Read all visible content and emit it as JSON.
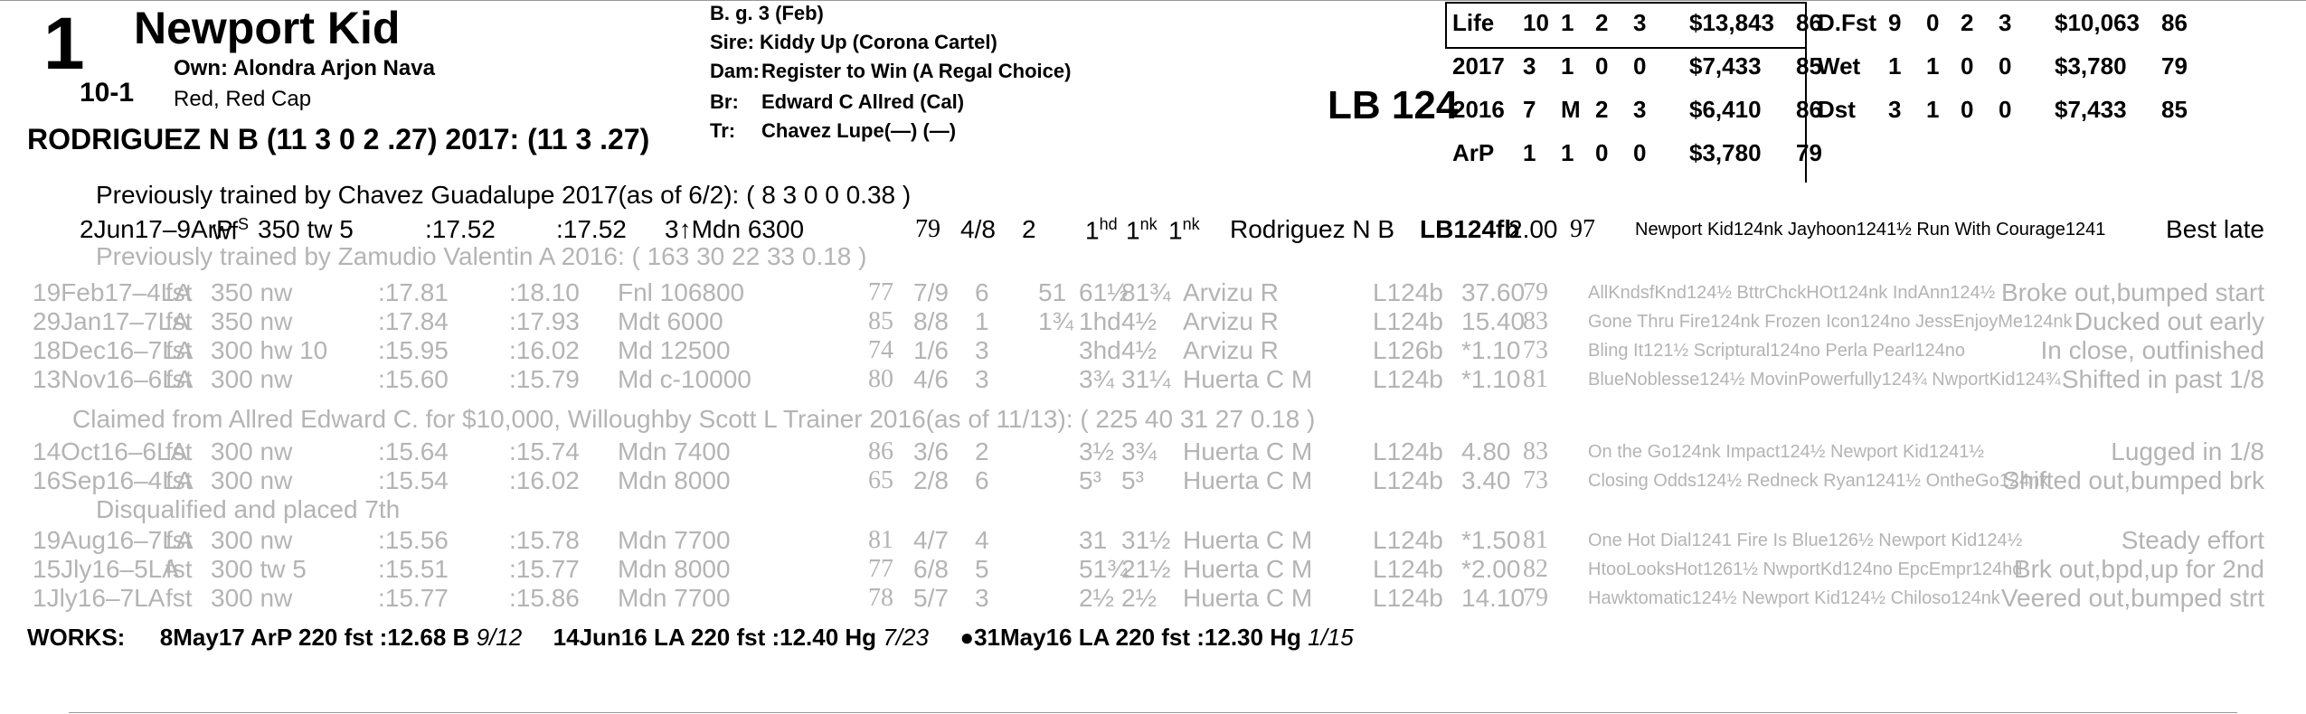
{
  "header": {
    "program_number": "1",
    "horse_name": "Newport Kid",
    "owner": "Own: Alondra Arjon Nava",
    "morning_line": "10-1",
    "silks": "Red, Red Cap",
    "jockey": "RODRIGUEZ N B (11 3 0 2 .27) 2017: (11 3 .27)",
    "sex_age": "B. g. 3 (Feb)",
    "sire_label": "Sire:",
    "sire": "Kiddy Up (Corona Cartel)",
    "dam_label": "Dam:",
    "dam": "Register to Win (A Regal Choice)",
    "breeder_label": "Br:",
    "breeder": "Edward C Allred (Cal)",
    "trainer_label": "Tr:",
    "trainer": "Chavez Lupe(—) (—)",
    "weight": "LB 124"
  },
  "stats_left": [
    {
      "label": "Life",
      "starts": "10",
      "w": "1",
      "p": "2",
      "s": "3",
      "earnings": "$13,843",
      "speed": "86"
    },
    {
      "label": "2017",
      "starts": "3",
      "w": "1",
      "p": "0",
      "s": "0",
      "earnings": "$7,433",
      "speed": "85"
    },
    {
      "label": "2016",
      "starts": "7",
      "w": "M",
      "p": "2",
      "s": "3",
      "earnings": "$6,410",
      "speed": "86"
    },
    {
      "label": "ArP",
      "starts": "1",
      "w": "1",
      "p": "0",
      "s": "0",
      "earnings": "$3,780",
      "speed": "79"
    }
  ],
  "stats_right": [
    {
      "label": "D.Fst",
      "starts": "9",
      "w": "0",
      "p": "2",
      "s": "3",
      "earnings": "$10,063",
      "speed": "86"
    },
    {
      "label": "Wet",
      "starts": "1",
      "w": "1",
      "p": "0",
      "s": "0",
      "earnings": "$3,780",
      "speed": "79"
    },
    {
      "label": "Dst",
      "starts": "3",
      "w": "1",
      "p": "0",
      "s": "0",
      "earnings": "$7,433",
      "speed": "85"
    }
  ],
  "notes": {
    "trainer_change_1": "Previously trained by Chavez Guadalupe 2017(as of 6/2): ( 8 3 0 0 0.38 )",
    "trainer_change_2": "Previously trained by Zamudio Valentin A 2016: ( 163 30 22 33 0.18 )",
    "claimed": "Claimed from Allred Edward C. for $10,000, Willoughby Scott L Trainer 2016(as of 11/13): ( 225  40  31  27  0.18 )",
    "disqualified": "Disqualified and placed 7th"
  },
  "races": [
    {
      "date": "2Jun17–9ArP",
      "cond": "wf",
      "cond_sup": "S",
      "dist": "350 tw 5",
      "frac1": ":17.52",
      "final": ":17.52",
      "cls": "3↑Mdn 6300",
      "spd": "79",
      "pp": "4/8",
      "st": "2",
      "c1": "1",
      "c1s": "hd",
      "c2": "1",
      "c2s": "nk",
      "fin": "1",
      "fins": "nk",
      "jockey": "Rodriguez N B",
      "wt": "LB124fb",
      "odds": "2.00",
      "sr": "97",
      "comp": "Newport Kid124nk Jayhoon1241½ Run With Courage1241",
      "comment": "Best late"
    },
    {
      "date": "19Feb17–4LA",
      "cond": "fst",
      "cond_sup": "",
      "dist": "350 nw",
      "frac1": ":17.81",
      "final": ":18.10",
      "cls": "Fnl 106800",
      "spd": "77",
      "pp": "7/9",
      "st": "6",
      "c1": "51",
      "c1s": "",
      "c2": "61½",
      "c2s": "",
      "fin": "81¾",
      "fins": "",
      "jockey": "Arvizu R",
      "wt": "L124b",
      "odds": "37.60",
      "sr": "79",
      "comp": "AllKndsfKnd124½ BttrChckHOt124nk IndAnn124½",
      "comment": "Broke out,bumped start"
    },
    {
      "date": "29Jan17–7LA",
      "cond": "fst",
      "cond_sup": "",
      "dist": "350 nw",
      "frac1": ":17.84",
      "final": ":17.93",
      "cls": "Mdt 6000",
      "spd": "85",
      "pp": "8/8",
      "st": "1",
      "c1": "1¾",
      "c1s": "",
      "c2": "1hd",
      "c2s": "",
      "fin": "4½",
      "fins": "",
      "jockey": "Arvizu R",
      "wt": "L124b",
      "odds": "15.40",
      "sr": "83",
      "comp": "Gone Thru Fire124nk Frozen Icon124no JessEnjoyMe124nk",
      "comment": "Ducked out early"
    },
    {
      "date": "18Dec16–7LA",
      "cond": "fst",
      "cond_sup": "",
      "dist": "300 hw 10",
      "frac1": ":15.95",
      "final": ":16.02",
      "cls": "Md 12500",
      "spd": "74",
      "pp": "1/6",
      "st": "3",
      "c1": "",
      "c1s": "",
      "c2": "3hd",
      "c2s": "",
      "fin": "4½",
      "fins": "",
      "jockey": "Arvizu R",
      "wt": "L126b",
      "odds": "*1.10",
      "sr": "73",
      "comp": "Bling It121½ Scriptural124no Perla Pearl124no",
      "comment": "In close, outfinished"
    },
    {
      "date": "13Nov16–6LA",
      "cond": "fst",
      "cond_sup": "",
      "dist": "300 nw",
      "frac1": ":15.60",
      "final": ":15.79",
      "cls": "Md c-10000",
      "spd": "80",
      "pp": "4/6",
      "st": "3",
      "c1": "",
      "c1s": "",
      "c2": "3¾",
      "c2s": "",
      "fin": "31¼",
      "fins": "",
      "jockey": "Huerta C M",
      "wt": "L124b",
      "odds": "*1.10",
      "sr": "81",
      "comp": "BlueNoblesse124½ MovinPowerfully124¾ NwportKid124¾",
      "comment": "Shifted in past 1/8"
    },
    {
      "date": "14Oct16–6LA",
      "cond": "fst",
      "cond_sup": "",
      "dist": "300 nw",
      "frac1": ":15.64",
      "final": ":15.74",
      "cls": "Mdn 7400",
      "spd": "86",
      "pp": "3/6",
      "st": "2",
      "c1": "",
      "c1s": "",
      "c2": "3½",
      "c2s": "",
      "fin": "3¾",
      "fins": "",
      "jockey": "Huerta C M",
      "wt": "L124b",
      "odds": "4.80",
      "sr": "83",
      "comp": "On the Go124nk Impact124½ Newport Kid1241½",
      "comment": "Lugged in 1/8"
    },
    {
      "date": "16Sep16–4LA",
      "cond": "fst",
      "cond_sup": "",
      "dist": "300 nw",
      "frac1": ":15.54",
      "final": ":16.02",
      "cls": "Mdn 8000",
      "spd": "65",
      "pp": "2/8",
      "st": "6",
      "c1": "",
      "c1s": "",
      "c2": "5³",
      "c2s": "",
      "fin": "5³",
      "fins": "",
      "jockey": "Huerta C M",
      "wt": "L124b",
      "odds": "3.40",
      "sr": "73",
      "comp": "Closing Odds124½ Redneck Ryan1241½ OntheGo124nk",
      "comment": "Shifted out,bumped brk"
    },
    {
      "date": "19Aug16–7LA",
      "cond": "fst",
      "cond_sup": "",
      "dist": "300 nw",
      "frac1": ":15.56",
      "final": ":15.78",
      "cls": "Mdn 7700",
      "spd": "81",
      "pp": "4/7",
      "st": "4",
      "c1": "",
      "c1s": "",
      "c2": "31",
      "c2s": "",
      "fin": "31½",
      "fins": "",
      "jockey": "Huerta C M",
      "wt": "L124b",
      "odds": "*1.50",
      "sr": "81",
      "comp": "One Hot Dial1241 Fire Is Blue126½ Newport Kid124½",
      "comment": "Steady effort"
    },
    {
      "date": "15Jly16–5LA",
      "cond": "fst",
      "cond_sup": "",
      "dist": "300 tw 5",
      "frac1": ":15.51",
      "final": ":15.77",
      "cls": "Mdn 8000",
      "spd": "77",
      "pp": "6/8",
      "st": "5",
      "c1": "",
      "c1s": "",
      "c2": "51¾",
      "c2s": "",
      "fin": "21½",
      "fins": "",
      "jockey": "Huerta C M",
      "wt": "L124b",
      "odds": "*2.00",
      "sr": "82",
      "comp": "HtooLooksHot1261½ NwportKd124no EpcEmpr124hd",
      "comment": "Brk out,bpd,up for 2nd"
    },
    {
      "date": "1Jly16–7LA",
      "cond": "fst",
      "cond_sup": "",
      "dist": "300 nw",
      "frac1": ":15.77",
      "final": ":15.86",
      "cls": "Mdn 7700",
      "spd": "78",
      "pp": "5/7",
      "st": "3",
      "c1": "",
      "c1s": "",
      "c2": "2½",
      "c2s": "",
      "fin": "2½",
      "fins": "",
      "jockey": "Huerta C M",
      "wt": "L124b",
      "odds": "14.10",
      "sr": "79",
      "comp": "Hawktomatic124½ Newport Kid124½ Chiloso124nk",
      "comment": "Veered out,bumped strt"
    }
  ],
  "works": {
    "label": "WORKS:",
    "items": [
      {
        "text": "8May17 ArP 220 fst :12.68 B",
        "rank": "9/12"
      },
      {
        "text": "14Jun16 LA 220 fst :12.40 Hg",
        "rank": "7/23"
      },
      {
        "text": "●31May16 LA 220 fst :12.30 Hg",
        "rank": "1/15"
      }
    ]
  }
}
